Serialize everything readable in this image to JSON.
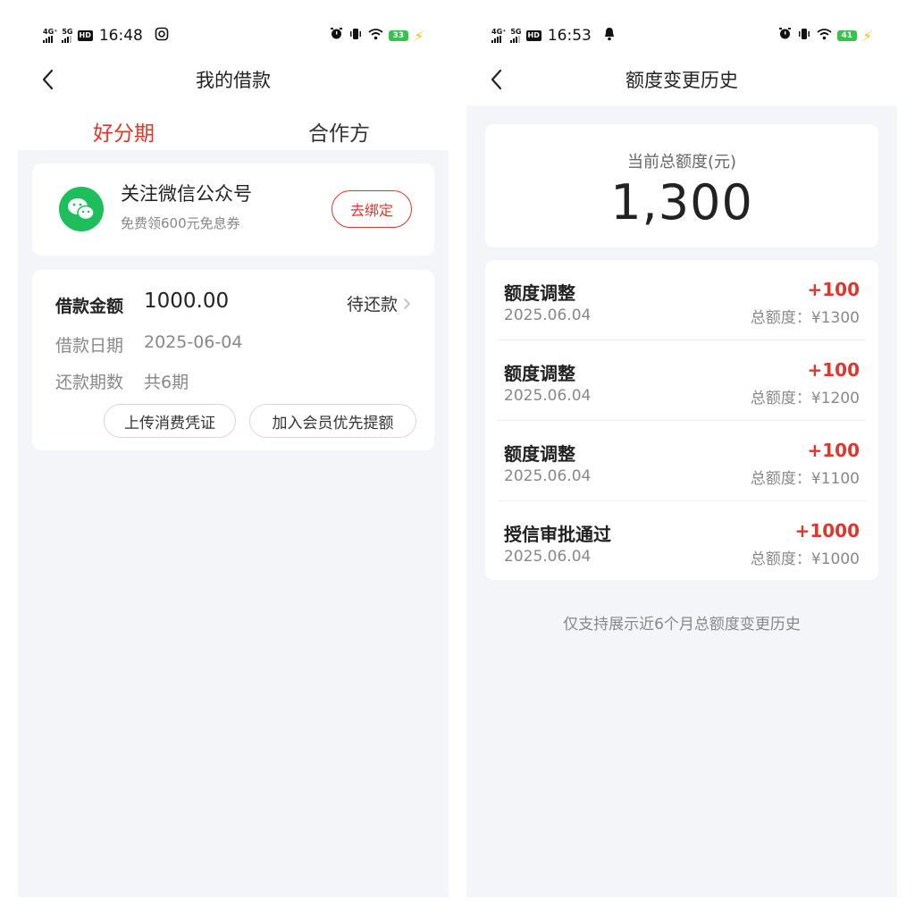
{
  "left_screen": {
    "status_bar": {
      "network": "4G⁺",
      "network2": "5G",
      "hd": "HD",
      "time": "16:48",
      "battery": "33"
    },
    "nav": {
      "title": "我的借款"
    },
    "tabs": [
      {
        "label": "好分期",
        "active": true
      },
      {
        "label": "合作方",
        "active": false
      }
    ],
    "wechat_card": {
      "title": "关注微信公众号",
      "subtitle": "免费领600元免息券",
      "button": "去绑定"
    },
    "loan_card": {
      "amount_label": "借款金额",
      "amount_value": "1000.00",
      "status": "待还款",
      "date_label": "借款日期",
      "date_value": "2025-06-04",
      "periods_label": "还款期数",
      "periods_value": "共6期",
      "upload_button": "上传消费凭证",
      "vip_button": "加入会员优先提额"
    }
  },
  "right_screen": {
    "status_bar": {
      "network": "4G⁺",
      "network2": "5G",
      "hd": "HD",
      "time": "16:53",
      "battery": "41"
    },
    "nav": {
      "title": "额度变更历史"
    },
    "total": {
      "label": "当前总额度(元)",
      "value": "1,300"
    },
    "history": [
      {
        "title": "额度调整",
        "date": "2025.06.04",
        "delta": "+100",
        "total": "总额度：¥1300"
      },
      {
        "title": "额度调整",
        "date": "2025.06.04",
        "delta": "+100",
        "total": "总额度：¥1200"
      },
      {
        "title": "额度调整",
        "date": "2025.06.04",
        "delta": "+100",
        "total": "总额度：¥1100"
      },
      {
        "title": "授信审批通过",
        "date": "2025.06.04",
        "delta": "+1000",
        "total": "总额度：¥1000"
      }
    ],
    "footer_note": "仅支持展示近6个月总额度变更历史"
  },
  "colors": {
    "accent_red": "#e1362c",
    "wechat_green": "#1dbe5b",
    "page_bg": "#f4f5f9",
    "battery_green": "#36c24c"
  }
}
